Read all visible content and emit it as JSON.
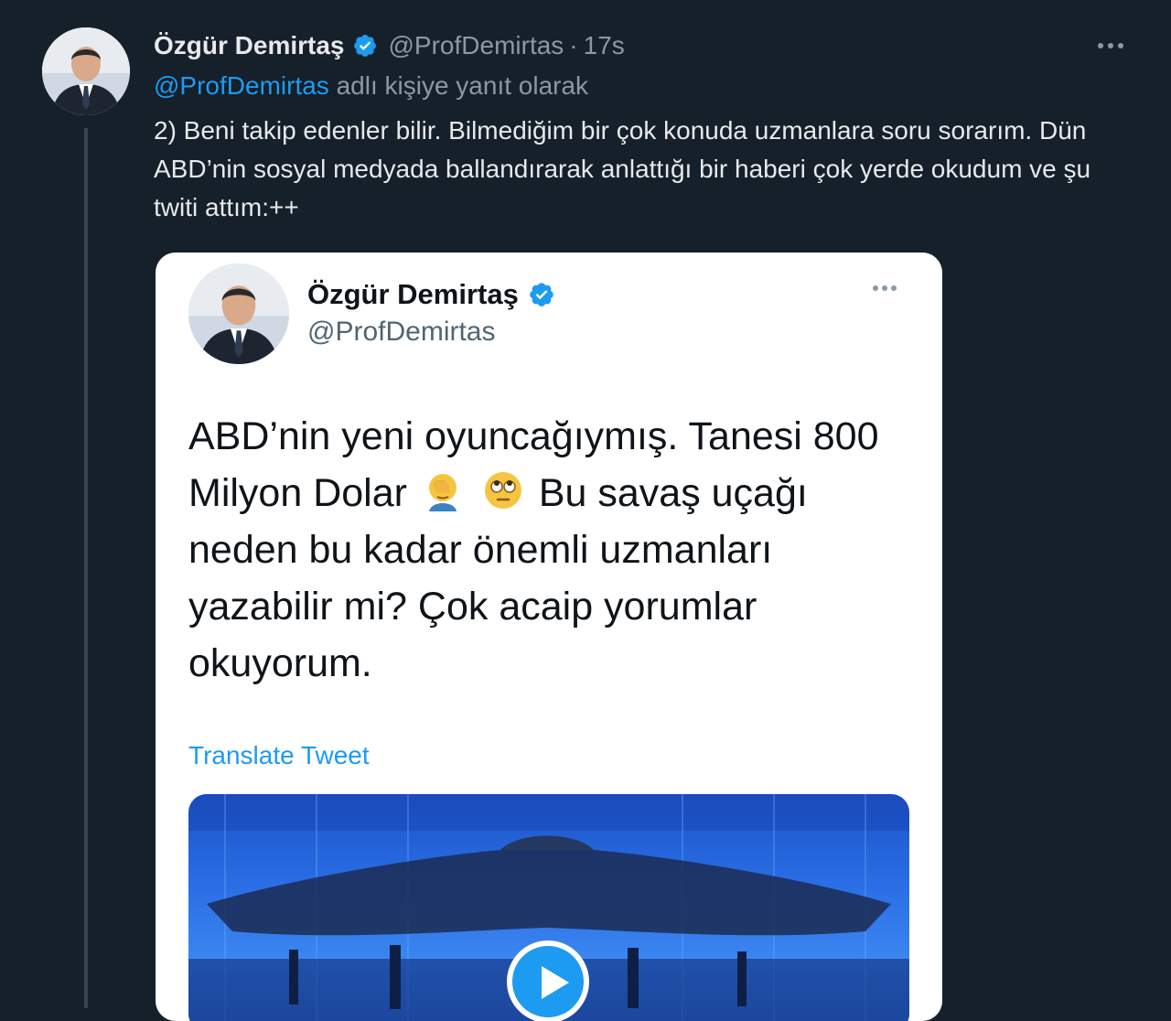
{
  "tweet": {
    "author_name": "Özgür Demirtaş",
    "handle": "@ProfDemirtas",
    "separator": "·",
    "time": "17s",
    "reply_mention": "@ProfDemirtas",
    "reply_text": "adlı kişiye yanıt olarak",
    "text": "2) Beni takip edenler bilir. Bilmediğim bir çok konuda uzmanlara soru sorarım. Dün ABD’nin sosyal medyada ballandırarak anlattığı bir haberi çok yerde okudum ve şu twiti attım:++",
    "avatar_icon": "profile-photo",
    "verified_icon": "verified-badge-icon",
    "more_icon": "more-options-icon"
  },
  "embedded": {
    "author_name": "Özgür Demirtaş",
    "handle": "@ProfDemirtas",
    "text_part1": "ABD’nin yeni oyuncağıymış. Tanesi 800 Milyon Dolar",
    "text_part2": "Bu savaş uçağı neden bu kadar önemli uzmanları yazabilir mi? Çok acaip yorumlar okuyorum.",
    "emojis": [
      "facepalm-emoji",
      "eye-roll-emoji"
    ],
    "translate_label": "Translate Tweet",
    "media_type": "video",
    "play_icon": "play-icon"
  },
  "colors": {
    "background": "#15202b",
    "accent": "#1d9bf0",
    "text_primary": "#e7e9ea",
    "text_secondary": "#8b98a5",
    "card_background": "#ffffff"
  }
}
